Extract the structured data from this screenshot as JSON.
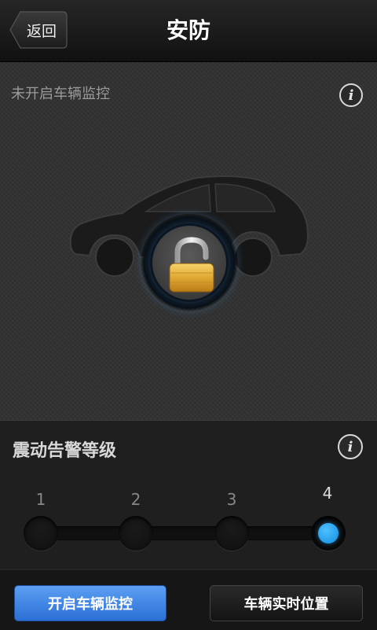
{
  "header": {
    "back_label": "返回",
    "title": "安防"
  },
  "status": {
    "text": "未开启车辆监控",
    "lock_state": "unlocked",
    "info_icon": "info-icon"
  },
  "vibration": {
    "title": "震动告警等级",
    "levels": [
      "1",
      "2",
      "3",
      "4"
    ],
    "selected_level": "4",
    "accent_color": "#1a9af0"
  },
  "actions": {
    "start_monitor": "开启车辆监控",
    "realtime_location": "车辆实时位置"
  }
}
